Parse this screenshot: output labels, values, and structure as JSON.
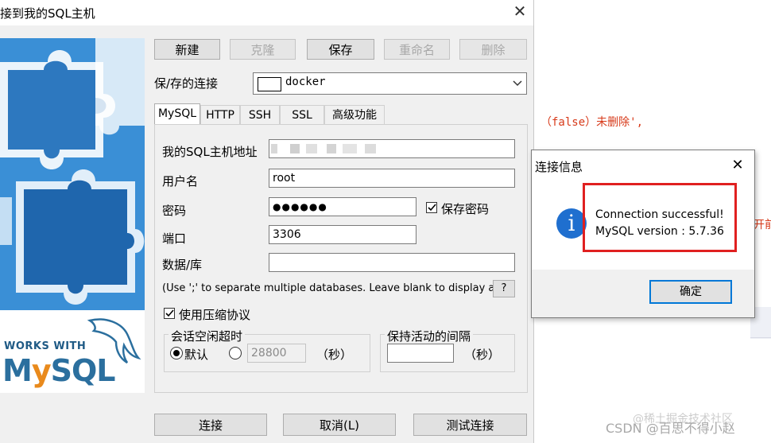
{
  "main_window": {
    "title": "接到我的SQL主机",
    "toolbar": {
      "new": "新建",
      "clone": "克隆",
      "save": "保存",
      "rename": "重命名",
      "delete": "删除"
    },
    "saved_connections_label": "保/存的连接",
    "saved_connection_value": "docker",
    "tabs": [
      "MySQL",
      "HTTP",
      "SSH",
      "SSL",
      "高级功能"
    ],
    "active_tab": "MySQL",
    "fields": {
      "host_label": "我的SQL主机地址",
      "host_value": "",
      "user_label": "用户名",
      "user_value": "root",
      "password_label": "密码",
      "password_value": "●●●●●●",
      "save_password_label": "保存密码",
      "port_label": "端口",
      "port_value": "3306",
      "database_label": "数据/库",
      "database_value": "",
      "database_hint": "(Use ';' to separate multiple databases. Leave blank to display all)",
      "help_label": "?"
    },
    "compression_label": "使用压缩协议",
    "session_timeout": {
      "title": "会话空闲超时",
      "default_label": "默认",
      "custom_value": "28800",
      "unit": "（秒）"
    },
    "keepalive": {
      "title": "保持活动的间隔",
      "value": "",
      "unit": "（秒）"
    },
    "bottom_buttons": {
      "connect": "连接",
      "cancel": "取消(L)",
      "test": "测试连接"
    },
    "logo": {
      "works_with": "WORKS WITH",
      "brand": "MySQL"
    }
  },
  "info_dialog": {
    "title": "连接信息",
    "message_line1": "Connection successful!",
    "message_line2": "MySQL version : 5.7.36",
    "ok_label": "确定"
  },
  "background": {
    "code_line": "（false）未删除',",
    "code_fragment": "开前",
    "watermark": "CSDN @百思不得小赵",
    "watermark2": "@稀土掘金技术社区"
  },
  "colors": {
    "accent": "#0078d7",
    "highlight": "#e02020",
    "code_red": "#d73a1a",
    "puzzle_blue": "#3a8fd6"
  }
}
